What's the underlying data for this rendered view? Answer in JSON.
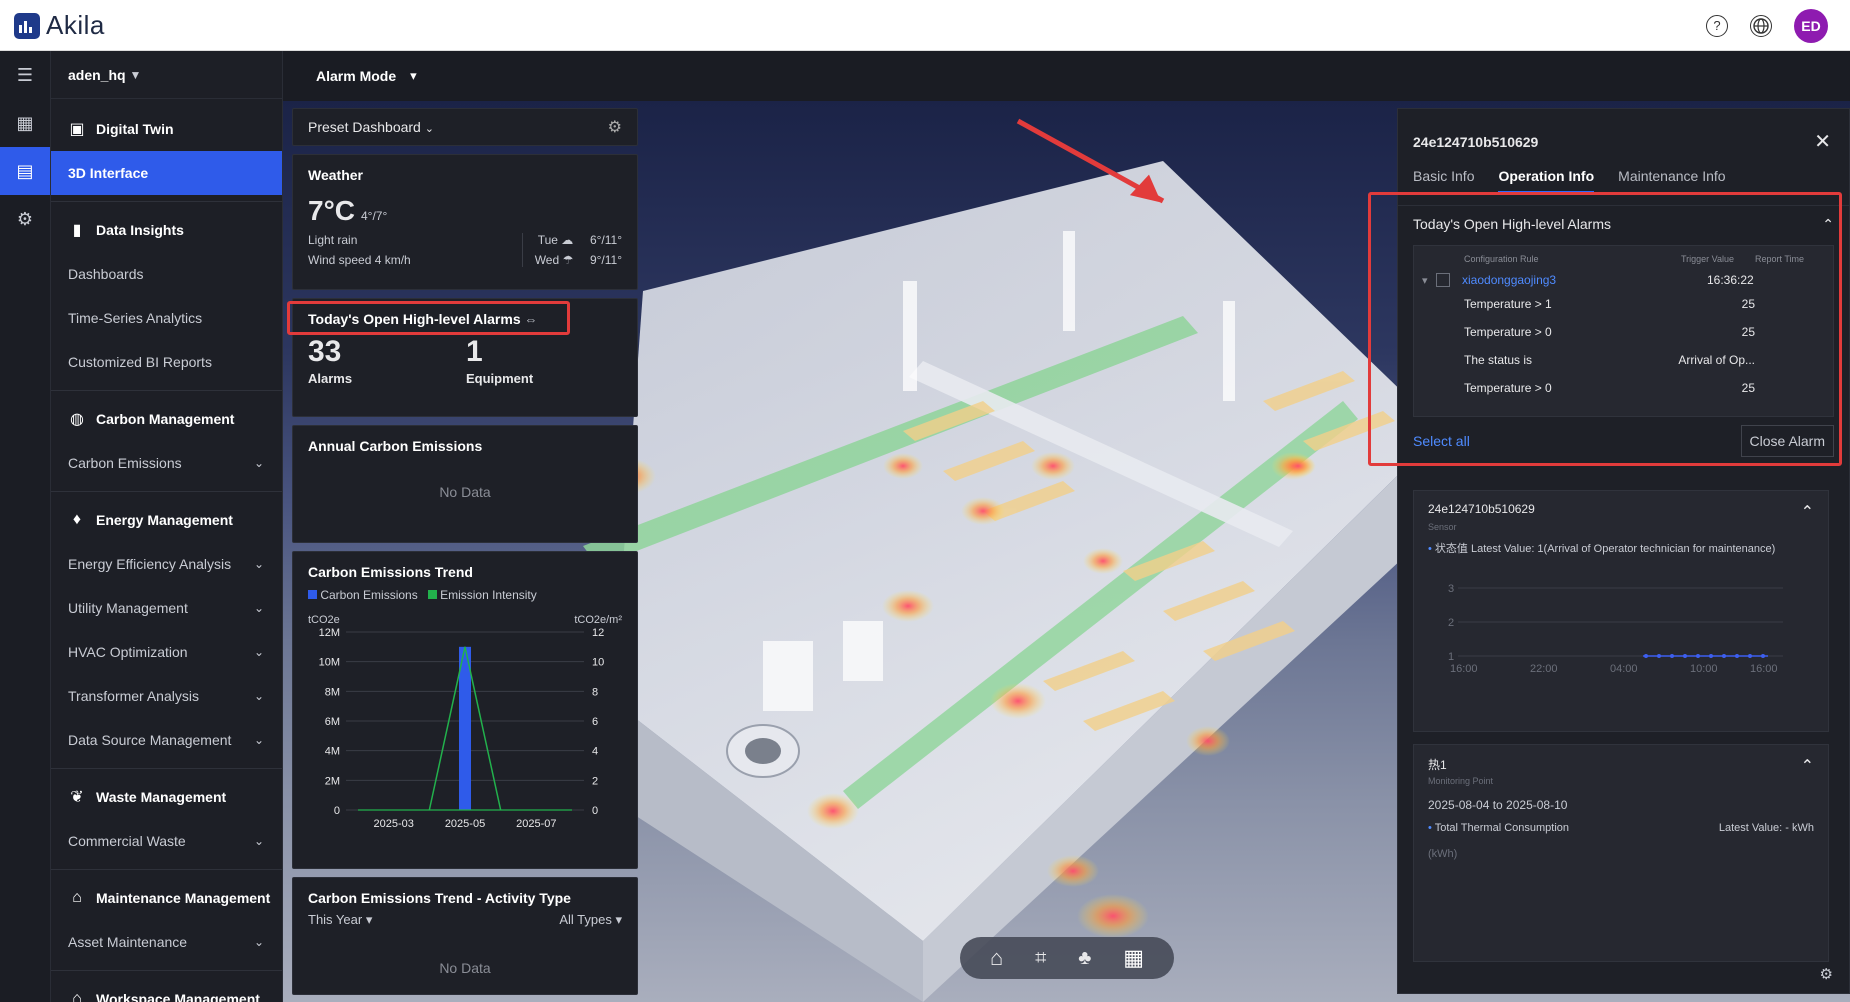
{
  "app": {
    "name": "Akila"
  },
  "topbar": {
    "help_icon": "question-circle-icon",
    "language_icon": "globe-icon",
    "avatar_initials": "ED"
  },
  "sidebar": {
    "site": "aden_hq",
    "sections": [
      {
        "label": "Digital Twin",
        "icon": "building-icon"
      },
      {
        "label": "Data Insights",
        "icon": "bar-chart-icon"
      },
      {
        "label": "Carbon Management",
        "icon": "globe-leaf-icon"
      },
      {
        "label": "Energy Management",
        "icon": "flame-icon"
      },
      {
        "label": "Waste Management",
        "icon": "leaf-icon"
      },
      {
        "label": "Maintenance Management",
        "icon": "house-wrench-icon"
      },
      {
        "label": "Workspace Management",
        "icon": "workspace-icon"
      }
    ],
    "items": {
      "interface_3d": "3D Interface",
      "dashboards": "Dashboards",
      "time_series": "Time-Series Analytics",
      "bi_reports": "Customized BI Reports",
      "carbon_emissions": "Carbon Emissions",
      "energy_efficiency": "Energy Efficiency Analysis",
      "utility": "Utility Management",
      "hvac": "HVAC Optimization",
      "transformer": "Transformer Analysis",
      "data_source": "Data Source Management",
      "commercial_waste": "Commercial Waste",
      "asset_maintenance": "Asset Maintenance"
    }
  },
  "modebar": {
    "label": "Alarm Mode"
  },
  "dashboard": {
    "preset": "Preset Dashboard",
    "weather": {
      "title": "Weather",
      "temp": "7°C",
      "range": "4°/7°",
      "condition": "Light rain",
      "wind": "Wind speed 4 km/h",
      "forecast": [
        {
          "day": "Tue",
          "range": "6°/11°"
        },
        {
          "day": "Wed",
          "range": "9°/11°"
        }
      ]
    },
    "alarms": {
      "title": "Today's Open High-level Alarms",
      "count": "33",
      "count_label": "Alarms",
      "equipment": "1",
      "equipment_label": "Equipment"
    },
    "annual": {
      "title": "Annual Carbon Emissions",
      "empty": "No Data"
    },
    "trend": {
      "title": "Carbon Emissions Trend",
      "legend": [
        {
          "name": "Carbon Emissions",
          "color": "#2f5bea"
        },
        {
          "name": "Emission Intensity",
          "color": "#22b14c"
        }
      ],
      "left_unit": "tCO2e",
      "right_unit": "tCO2e/m²"
    },
    "activity": {
      "title": "Carbon Emissions Trend - Activity Type",
      "period": "This Year",
      "types": "All Types",
      "empty": "No Data"
    }
  },
  "chart_data": {
    "type": "bar",
    "title": "Carbon Emissions Trend",
    "x_ticks": [
      "2025-03",
      "2025-05",
      "2025-07"
    ],
    "y_left_ticks": [
      "12M",
      "10M",
      "8M",
      "6M",
      "4M",
      "2M",
      "0"
    ],
    "y_right_ticks": [
      "12",
      "10",
      "8",
      "6",
      "4",
      "2",
      "0"
    ],
    "ylim_left": [
      0,
      12000000
    ],
    "ylim_right": [
      0,
      12
    ],
    "series": [
      {
        "name": "Carbon Emissions",
        "type": "bar",
        "x": [
          "2025-05"
        ],
        "values": [
          11000000
        ]
      },
      {
        "name": "Emission Intensity",
        "type": "line",
        "x": [
          "2025-04",
          "2025-05",
          "2025-06"
        ],
        "values": [
          0,
          11,
          0
        ]
      }
    ],
    "grid": true,
    "legend": "top-left"
  },
  "info_panel": {
    "device_id": "24e124710b510629",
    "tabs": [
      "Basic Info",
      "Operation Info",
      "Maintenance Info"
    ],
    "alarm_box": {
      "title": "Today's Open High-level Alarms",
      "columns": [
        "Configuration Rule",
        "Trigger Value",
        "Report Time"
      ],
      "group": {
        "name": "xiaodonggaojing3",
        "time": "16:36:22"
      },
      "rows": [
        {
          "rule": "Temperature > 1",
          "value": "25"
        },
        {
          "rule": "Temperature > 0",
          "value": "25"
        },
        {
          "rule": "The status is",
          "value": "Arrival of Op..."
        },
        {
          "rule": "Temperature > 0",
          "value": "25"
        }
      ],
      "select_all": "Select all",
      "close_alarm": "Close Alarm"
    },
    "sensor": {
      "name": "24e124710b510629",
      "type": "Sensor",
      "latest": "状态值 Latest Value: 1(Arrival of Operator technician for maintenance)",
      "y_ticks": [
        "3",
        "2",
        "1"
      ],
      "x_ticks": [
        "16:00",
        "22:00",
        "04:00",
        "10:00",
        "16:00"
      ]
    },
    "monitor": {
      "name": "热1",
      "type": "Monitoring Point",
      "range": "2025-08-04 to 2025-08-10",
      "metric": "Total Thermal Consumption",
      "latest": "Latest Value: - kWh",
      "unit": "(kWh)"
    }
  }
}
